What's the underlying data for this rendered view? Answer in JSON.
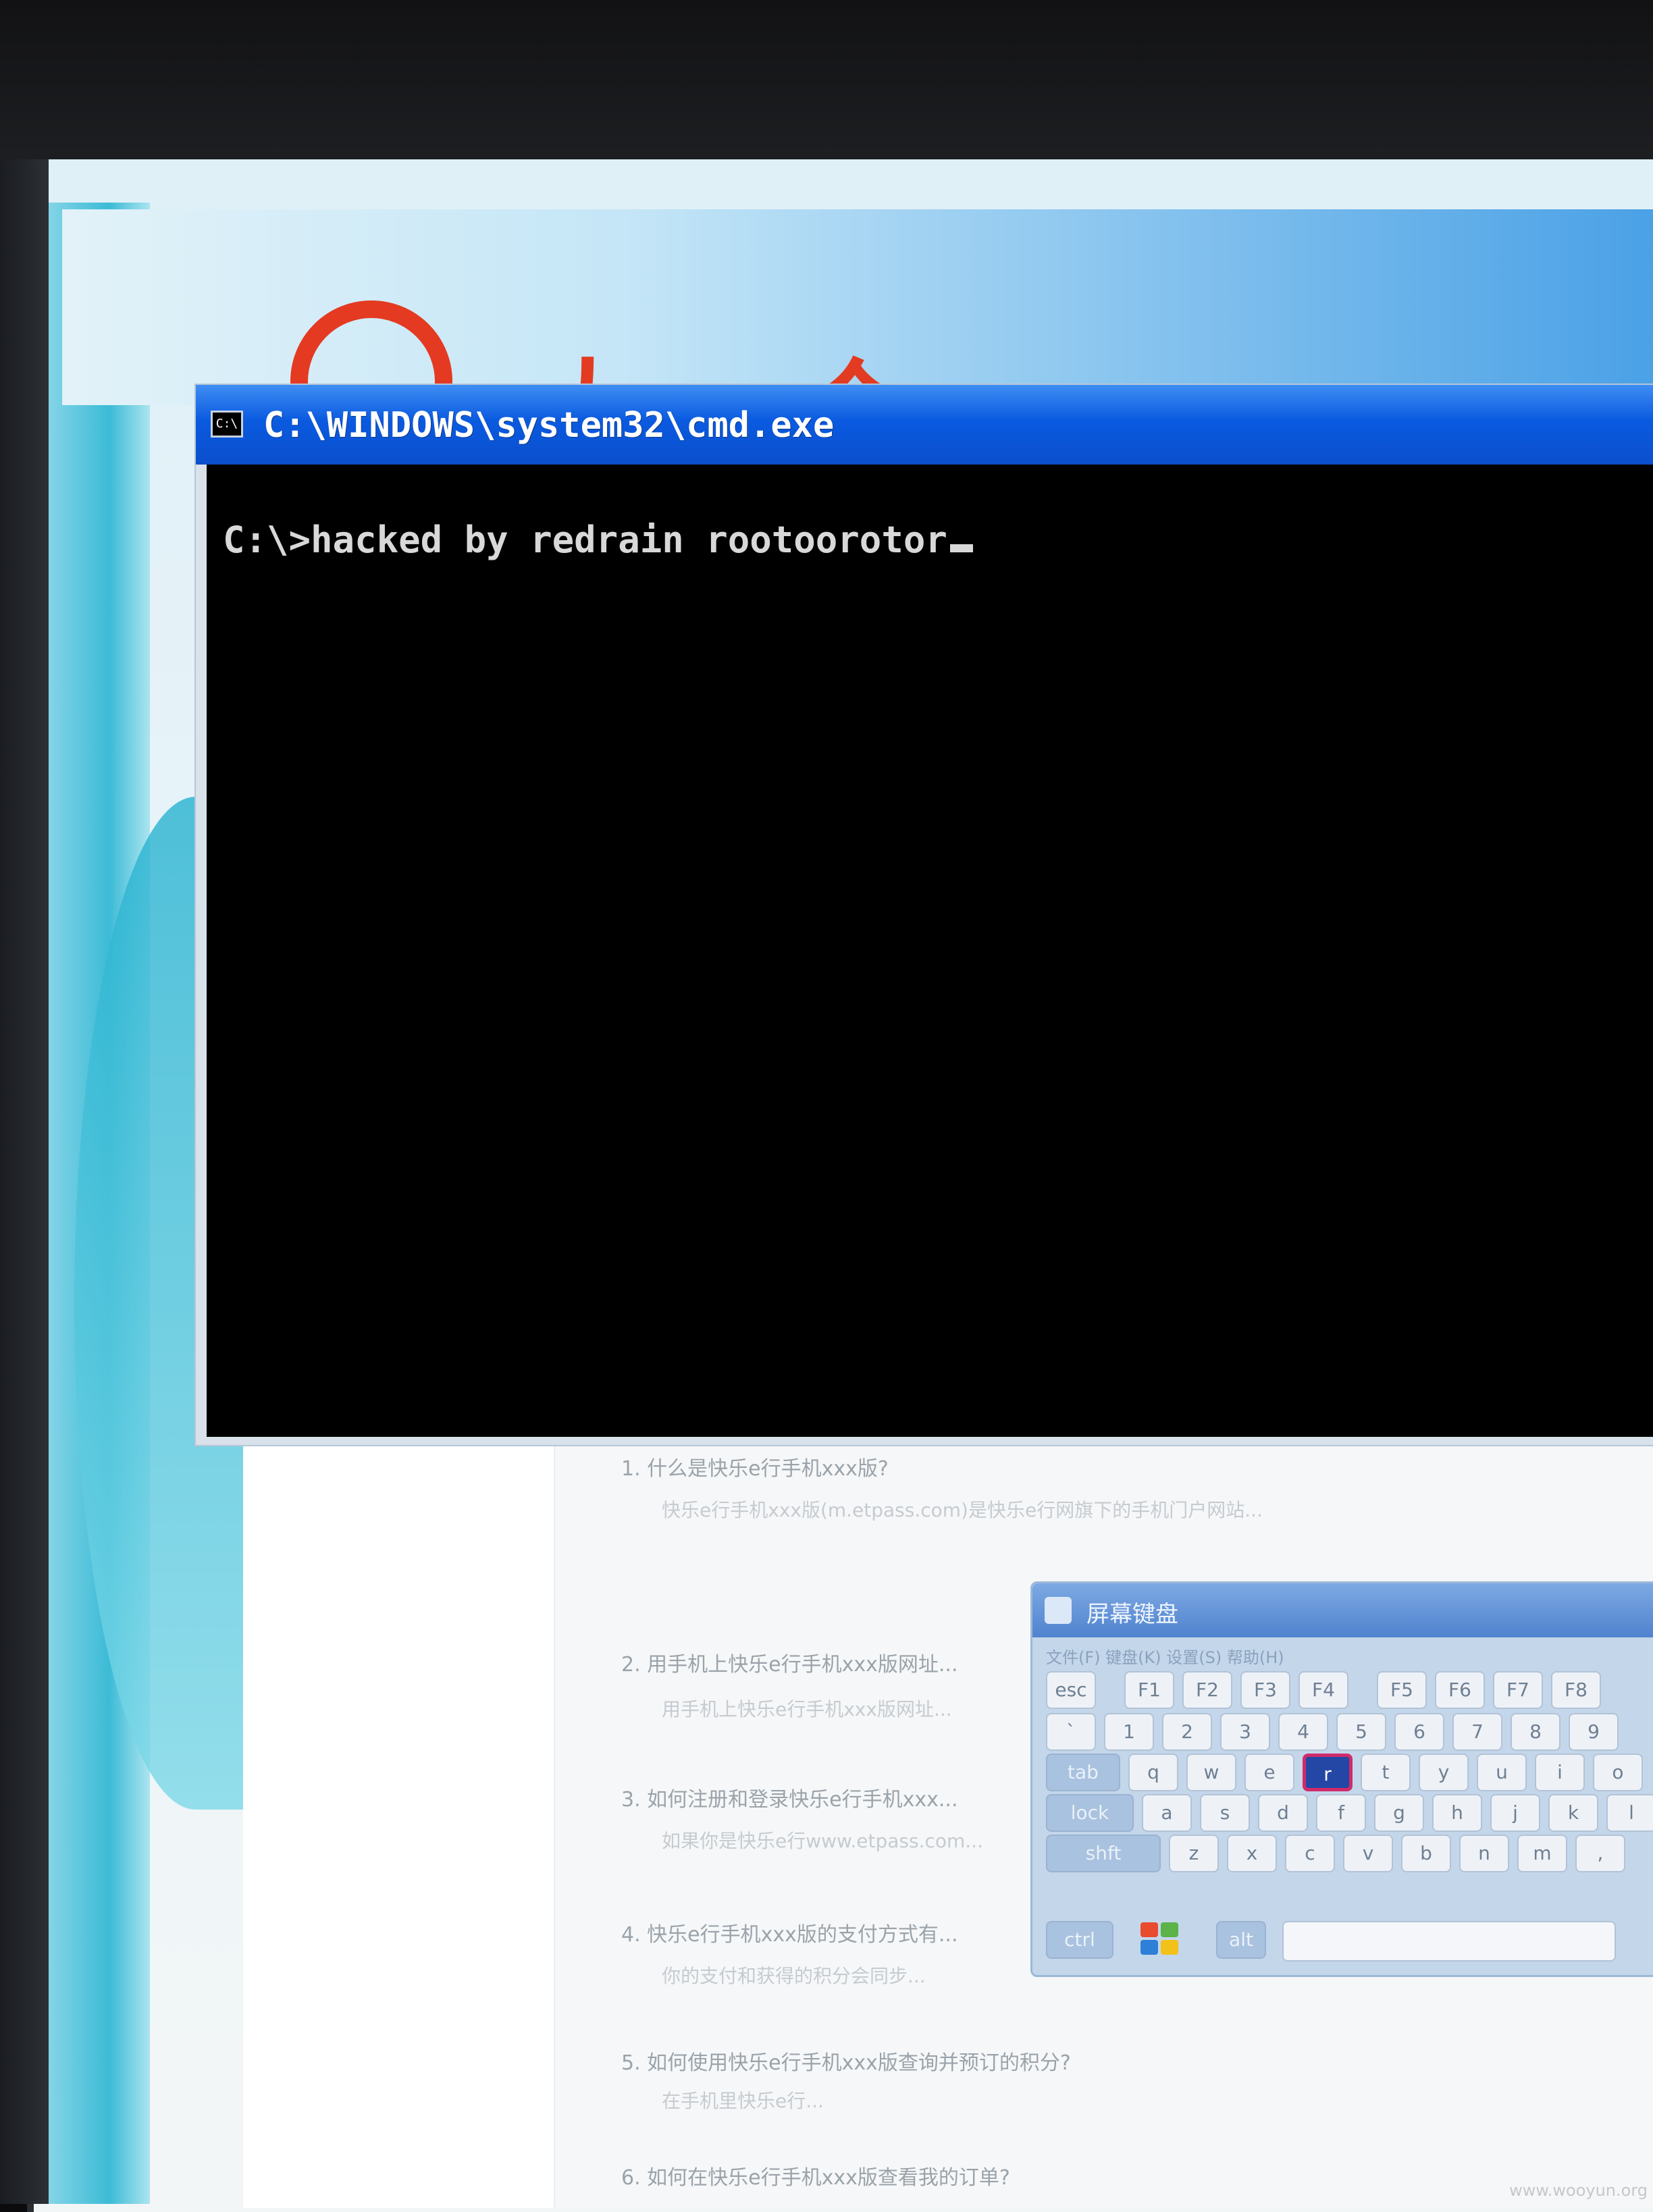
{
  "cmd_window": {
    "title": "C:\\WINDOWS\\system32\\cmd.exe",
    "icon_label": "C:\\",
    "prompt_line": "C:\\>hacked by redrain rootoorotor"
  },
  "article": {
    "items": [
      {
        "q": "1. 什么是快乐e行手机xxx版?",
        "a": "快乐e行手机xxx版(m.etpass.com)是快乐e行网旗下的手机门户网站..."
      },
      {
        "q": "2. 用手机上快乐e行手机xxx版网址...",
        "a": "用手机上快乐e行手机xxx版网址..."
      },
      {
        "q": "3. 如何注册和登录快乐e行手机xxx...",
        "a": "如果你是快乐e行www.etpass.com..."
      },
      {
        "q": "4. 快乐e行手机xxx版的支付方式有...",
        "a": "你的支付和获得的积分会同步..."
      },
      {
        "q": "5. 如何使用快乐e行手机xxx版查询并预订的积分?",
        "a": "在手机里快乐e行..."
      },
      {
        "q": "6. 如何在快乐e行手机xxx版查看我的订单?",
        "a": ""
      }
    ]
  },
  "keyboard": {
    "title": "屏幕键盘",
    "menu": "文件(F)  键盘(K)  设置(S)  帮助(H)",
    "rows": [
      [
        "esc",
        "F1",
        "F2",
        "F3",
        "F4",
        "F5",
        "F6",
        "F7",
        "F8"
      ],
      [
        "`",
        "1",
        "2",
        "3",
        "4",
        "5",
        "6",
        "7",
        "8",
        "9"
      ],
      [
        "tab",
        "q",
        "w",
        "e",
        "r",
        "t",
        "y",
        "u",
        "i",
        "o"
      ],
      [
        "lock",
        "a",
        "s",
        "d",
        "f",
        "g",
        "h",
        "j",
        "k",
        "l"
      ],
      [
        "shft",
        "z",
        "x",
        "c",
        "v",
        "b",
        "n",
        "m",
        ","
      ],
      [
        "ctrl",
        "alt"
      ]
    ],
    "active_key": "r"
  },
  "watermark": "www.wooyun.org"
}
